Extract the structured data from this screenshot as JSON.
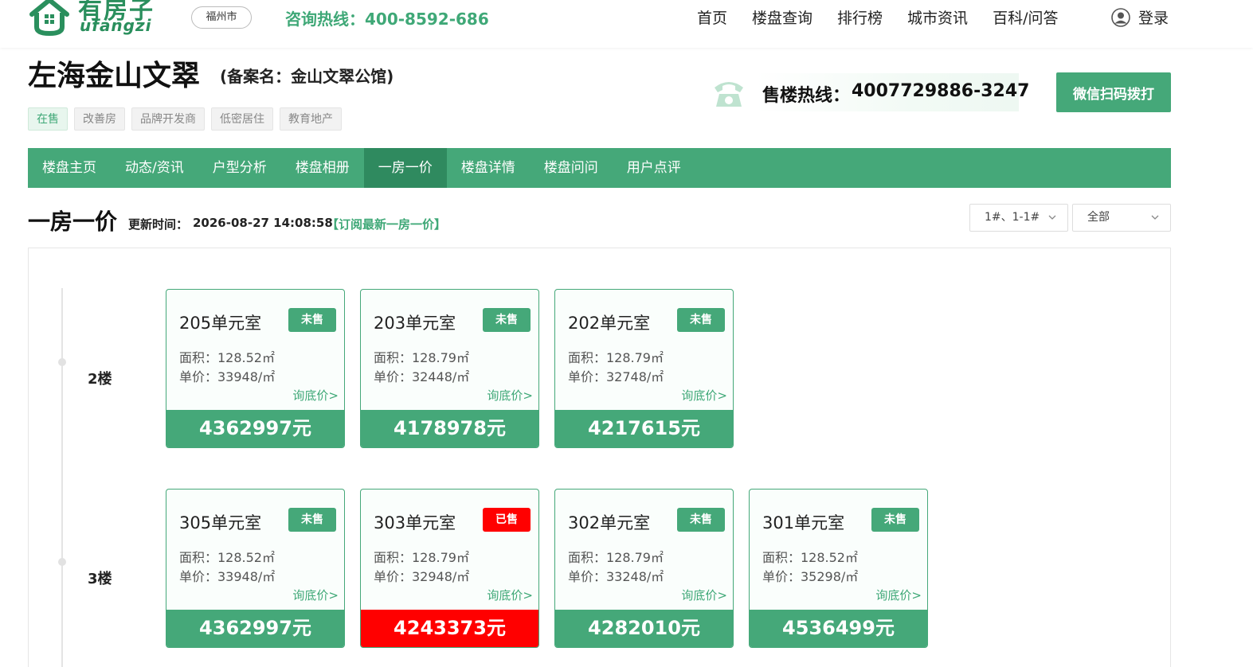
{
  "header": {
    "logo_cn": "有房子",
    "logo_en": "ufangzi",
    "city": "福州市",
    "hotline": "咨询热线：400-8592-686",
    "nav": [
      "首页",
      "楼盘查询",
      "排行榜",
      "城市资讯",
      "百科/问答"
    ],
    "login": "登录"
  },
  "project": {
    "name": "左海金山文翠",
    "alias": "(备案名：金山文翠公馆)",
    "tags": [
      "在售",
      "改善房",
      "品牌开发商",
      "低密居住",
      "教育地产"
    ],
    "sales_label": "售楼热线：",
    "sales_number": "4007729886-3247",
    "wechat_button": "微信扫码拨打"
  },
  "tabs": [
    "楼盘主页",
    "动态/资讯",
    "户型分析",
    "楼盘相册",
    "一房一价",
    "楼盘详情",
    "楼盘问问",
    "用户点评"
  ],
  "active_tab": "一房一价",
  "section": {
    "title": "一房一价",
    "update_label": "更新时间：",
    "update_time": "2026-08-27 14:08:58",
    "subscribe": "【订阅最新一房一价】",
    "building_select": "1#、1-1#",
    "status_select": "全部"
  },
  "floors": [
    {
      "label": "2楼",
      "units": [
        {
          "room": "205单元室",
          "status": "未售",
          "area": "面积：128.52㎡",
          "unit_price": "单价：33948/㎡",
          "ask": "询底价>",
          "total": "4362997元",
          "sold": false
        },
        {
          "room": "203单元室",
          "status": "未售",
          "area": "面积：128.79㎡",
          "unit_price": "单价：32448/㎡",
          "ask": "询底价>",
          "total": "4178978元",
          "sold": false
        },
        {
          "room": "202单元室",
          "status": "未售",
          "area": "面积：128.79㎡",
          "unit_price": "单价：32748/㎡",
          "ask": "询底价>",
          "total": "4217615元",
          "sold": false
        }
      ]
    },
    {
      "label": "3楼",
      "units": [
        {
          "room": "305单元室",
          "status": "未售",
          "area": "面积：128.52㎡",
          "unit_price": "单价：33948/㎡",
          "ask": "询底价>",
          "total": "4362997元",
          "sold": false
        },
        {
          "room": "303单元室",
          "status": "已售",
          "area": "面积：128.79㎡",
          "unit_price": "单价：32948/㎡",
          "ask": "询底价>",
          "total": "4243373元",
          "sold": true
        },
        {
          "room": "302单元室",
          "status": "未售",
          "area": "面积：128.79㎡",
          "unit_price": "单价：33248/㎡",
          "ask": "询底价>",
          "total": "4282010元",
          "sold": false
        },
        {
          "room": "301单元室",
          "status": "未售",
          "area": "面积：128.52㎡",
          "unit_price": "单价：35298/㎡",
          "ask": "询底价>",
          "total": "4536499元",
          "sold": false
        }
      ]
    }
  ],
  "colors": {
    "brand": "#45a879",
    "brand_dark": "#2f8a5f",
    "sold": "#ff0000",
    "text_green": "#3fa877"
  }
}
